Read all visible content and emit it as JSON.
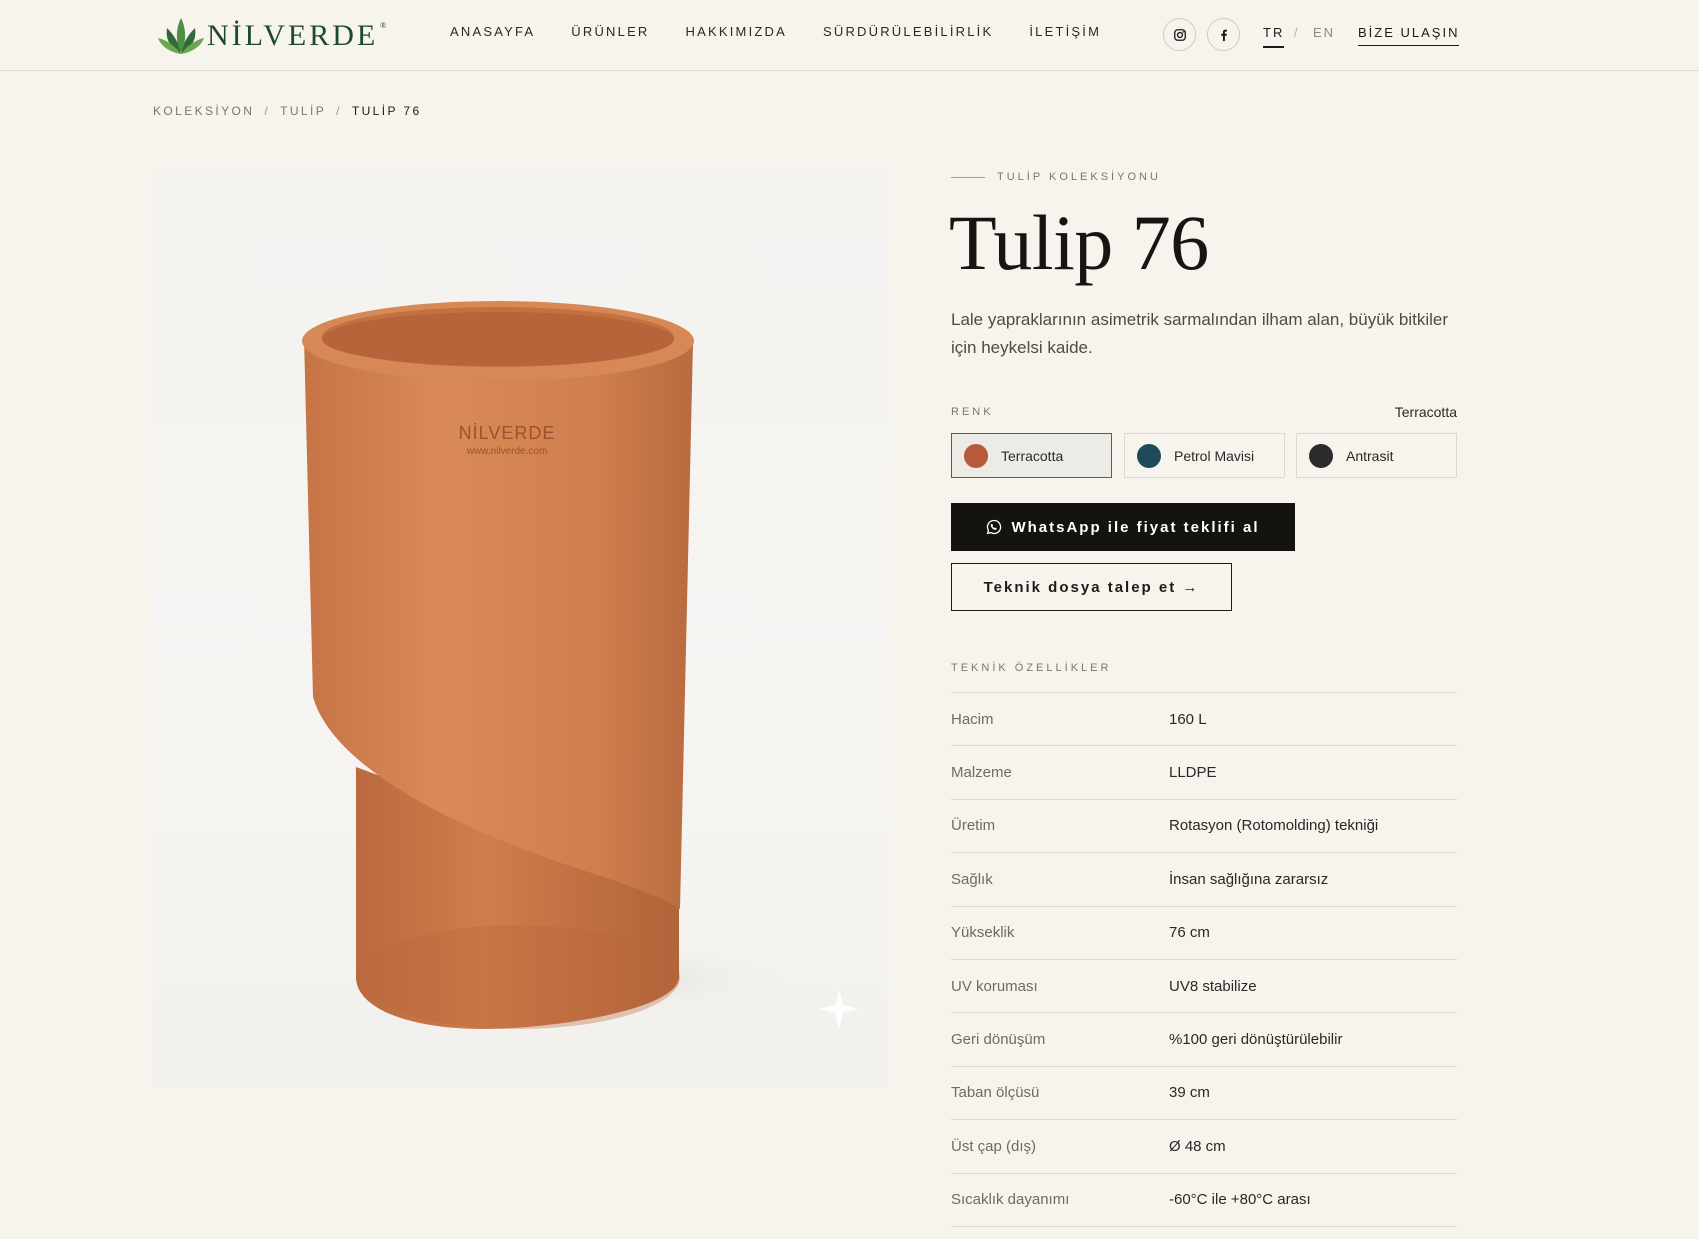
{
  "brand": {
    "name": "NİLVERDE",
    "registered": "®"
  },
  "nav": {
    "items": [
      {
        "label": "ANASAYFA"
      },
      {
        "label": "ÜRÜNLER"
      },
      {
        "label": "HAKKIMIZDA"
      },
      {
        "label": "SÜRDÜRÜLEBİLİRLİK"
      },
      {
        "label": "İLETİŞİM"
      }
    ]
  },
  "header": {
    "social": [
      {
        "icon": "instagram-icon"
      },
      {
        "icon": "facebook-icon"
      }
    ],
    "lang_tr": "TR",
    "lang_sep": "/",
    "lang_en": "EN",
    "contact_label": "BİZE ULAŞIN"
  },
  "breadcrumb": {
    "items": [
      "KOLEKSİYON",
      "TULİP",
      "TULİP 76"
    ],
    "separator": "/"
  },
  "product": {
    "image_logo_text": "NİLVERDE",
    "image_logo_url": "www.nilverde.com",
    "collection": "TULİP KOLEKSİYONU",
    "title": "Tulip 76",
    "description": "Lale yapraklarının asimetrik sarmalından ilham alan, büyük bitkiler için heykelsi kaide.",
    "color_label": "RENK",
    "selected_color": "Terracotta",
    "colors": [
      {
        "name": "Terracotta",
        "hex": "#b65a3a",
        "active": true
      },
      {
        "name": "Petrol Mavisi",
        "hex": "#1f4a5a",
        "active": false
      },
      {
        "name": "Antrasit",
        "hex": "#2b2b2b",
        "active": false
      }
    ],
    "whatsapp_button": "WhatsApp ile fiyat teklifi al",
    "tech_button": "Teknik dosya talep et →"
  },
  "specs": {
    "label": "TEKNİK ÖZELLİKLER",
    "rows": [
      {
        "key": "Hacim",
        "value": "160 L"
      },
      {
        "key": "Malzeme",
        "value": "LLDPE"
      },
      {
        "key": "Üretim",
        "value": "Rotasyon (Rotomolding) tekniği"
      },
      {
        "key": "Sağlık",
        "value": "İnsan sağlığına zararsız"
      },
      {
        "key": "Yükseklik",
        "value": "76 cm"
      },
      {
        "key": "UV koruması",
        "value": "UV8 stabilize"
      },
      {
        "key": "Geri dönüşüm",
        "value": "%100 geri dönüştürülebilir"
      },
      {
        "key": "Taban ölçüsü",
        "value": "39 cm"
      },
      {
        "key": "Üst çap (dış)",
        "value": "Ø 48 cm"
      },
      {
        "key": "Sıcaklık dayanımı",
        "value": "-60°C ile +80°C arası"
      }
    ]
  },
  "colors": {
    "background": "#f7f4ee",
    "brand_green": "#1d4a2a",
    "button_dark": "#15130f",
    "pot_terracotta": "#cf7f4f"
  }
}
